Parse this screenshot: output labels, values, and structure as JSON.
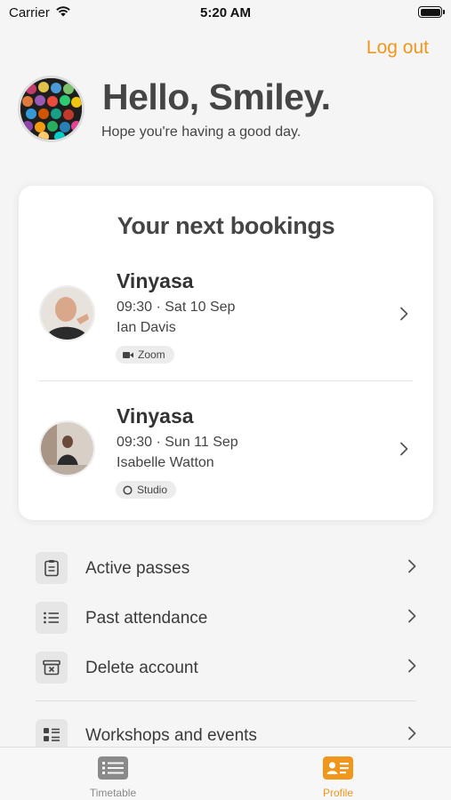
{
  "status_bar": {
    "carrier": "Carrier",
    "time": "5:20 AM"
  },
  "header": {
    "logout_label": "Log out",
    "greeting": "Hello, Smiley.",
    "subgreeting": "Hope you're having a good day."
  },
  "bookings": {
    "title": "Your next bookings",
    "items": [
      {
        "class_name": "Vinyasa",
        "datetime": "09:30 · Sat 10 Sep",
        "teacher": "Ian Davis",
        "location": "Zoom",
        "location_icon": "video-camera-icon"
      },
      {
        "class_name": "Vinyasa",
        "datetime": "09:30 · Sun 11 Sep",
        "teacher": "Isabelle Watton",
        "location": "Studio",
        "location_icon": "circle-icon"
      }
    ]
  },
  "menu": [
    {
      "label": "Active passes",
      "icon": "clipboard-icon"
    },
    {
      "label": "Past attendance",
      "icon": "list-icon"
    },
    {
      "label": "Delete account",
      "icon": "archive-delete-icon"
    },
    {
      "label": "Workshops and events",
      "icon": "list-detail-icon"
    }
  ],
  "tabbar": {
    "tabs": [
      {
        "label": "Timetable",
        "icon": "timetable-icon",
        "active": false
      },
      {
        "label": "Profile",
        "icon": "profile-card-icon",
        "active": true
      }
    ]
  },
  "colors": {
    "accent": "#f0961c",
    "text_dark": "#454545",
    "inactive": "#8a8a8a"
  }
}
